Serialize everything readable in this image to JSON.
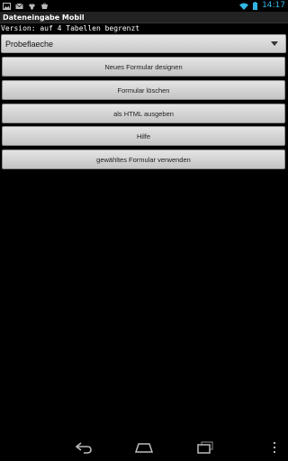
{
  "status_bar": {
    "left_icons": [
      "image-icon",
      "mail-icon",
      "flower-icon",
      "shop-icon"
    ],
    "right_icons": [
      "wifi-icon",
      "battery-icon"
    ],
    "time": "14:17",
    "accent_color": "#33b5e5"
  },
  "app": {
    "title": "Dateneingabe Mobil",
    "version_text": "Version: auf 4 Tabellen begrenzt"
  },
  "spinner": {
    "selected": "Probeflaeche"
  },
  "buttons": {
    "new_form": "Neues Formular designen",
    "delete_form": "Formular löschen",
    "export_html": "als HTML ausgeben",
    "help": "Hilfe",
    "use_form": "gewähltes Formular verwenden"
  },
  "nav_bar": {
    "icons": [
      "back-icon",
      "home-icon",
      "recent-apps-icon",
      "menu-icon"
    ]
  }
}
